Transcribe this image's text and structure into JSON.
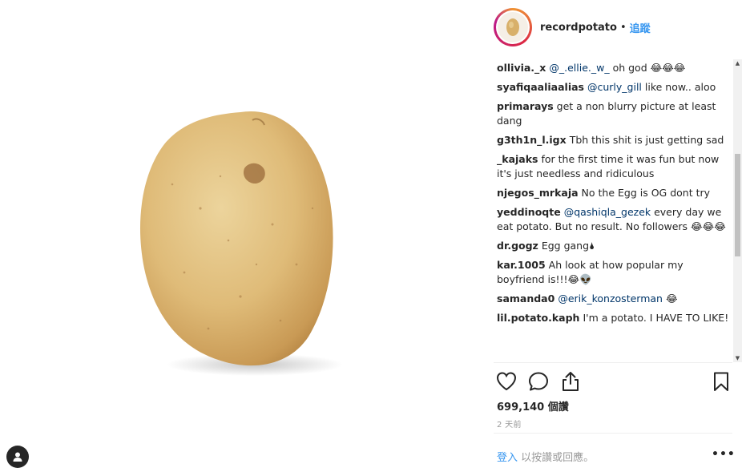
{
  "post": {
    "username": "recordpotato",
    "separator": "•",
    "follow_label": "追蹤",
    "likes": "699,140 個讚",
    "timestamp": "2 天前"
  },
  "comments": [
    {
      "user": "ollivia._x",
      "mention": "@_.ellie._w_",
      "text": " oh god 😂😂😂"
    },
    {
      "user": "syafiqaaliaalias",
      "mention": "@curly_gill",
      "text": " like now.. aloo"
    },
    {
      "user": "primarays",
      "mention": "",
      "text": "get a non blurry picture at least dang"
    },
    {
      "user": "g3th1n_l.igx",
      "mention": "",
      "text": "Tbh this shit is just getting sad"
    },
    {
      "user": "_kajaks",
      "mention": "",
      "text": "for the first time it was fun but now it's just needless and ridiculous"
    },
    {
      "user": "njegos_mrkaja",
      "mention": "",
      "text": "No the Egg is OG dont try"
    },
    {
      "user": "yeddinoqte",
      "mention": "@qashiqla_gezek",
      "text": " every day we eat potato. But no result. No followers 😂😂😂"
    },
    {
      "user": "dr.gogz",
      "mention": "",
      "text": "Egg gang🌢"
    },
    {
      "user": "kar.1005",
      "mention": "",
      "text": "Ah look at how popular my boyfriend is!!!😂👽"
    },
    {
      "user": "samanda0",
      "mention": "@erik_konzosterman",
      "text": " 😂"
    },
    {
      "user": "lil.potato.kaph",
      "mention": "",
      "text": "I'm a potato. I HAVE TO LIKE!"
    }
  ],
  "footer": {
    "login_link": "登入",
    "login_rest": " 以按讚或回應。",
    "more_label": "•••"
  },
  "icons": {
    "like": "heart-icon",
    "comment": "comment-icon",
    "share": "share-icon",
    "save": "bookmark-icon",
    "profile": "user-icon"
  },
  "colors": {
    "link": "#3897f0",
    "mention": "#003569",
    "muted": "#999999"
  }
}
